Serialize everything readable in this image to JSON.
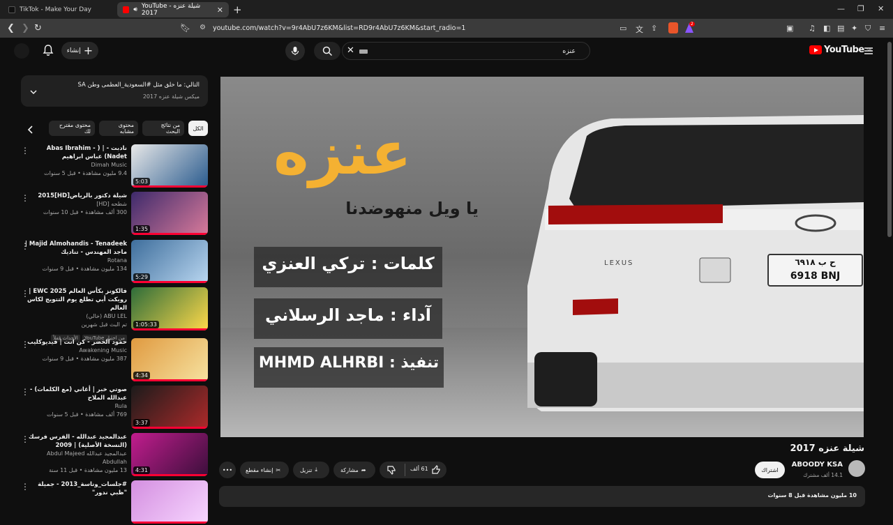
{
  "browser": {
    "tabs": [
      {
        "title": "TikTok - Make Your Day"
      },
      {
        "title": "YouTube - شيلة عنزه 2017"
      }
    ],
    "url": "youtube.com/watch?v=9r4AbU7z6KM&list=RD9r4AbU7z6KM&start_radio=1",
    "badge_count": "2"
  },
  "header": {
    "search_value": "عنزه",
    "create_label": "إنشاء",
    "logo_text": "YouTube",
    "logo_region": "SA"
  },
  "mix": {
    "now_playing": "التالي: ما خلق مثل #السعودية_العظمى وطن SA",
    "subtitle": "ميكس شيلة عنزه 2017"
  },
  "chips": [
    "الكل",
    "من نتائج البحث",
    "محتوى مشابه",
    "محتوى مقترح لك"
  ],
  "sidebar_items": [
    {
      "title": "نادبت - | ( Abas Ibrahim - Nadet) عباس ابراهيم",
      "channel": "Dimah Music",
      "views": "9.4 مليون مشاهدة • قبل 5 سنوات",
      "duration": "5:03",
      "badge": ""
    },
    {
      "title": "شيلة دكتور بالرياض[HD]2015",
      "channel": "شطحه [HD]",
      "views": "300 ألف مشاهدة • قبل 10 سنوات",
      "duration": "1:35",
      "badge": ""
    },
    {
      "title": "Majid Almohandis - Tenadeek | ماجد المهندس - تناديك",
      "channel": "Rotana",
      "views": "134 مليون مشاهدة • قبل 9 سنوات",
      "duration": "5:29",
      "badge": ""
    },
    {
      "title": "فالكونز بكأس العالم EWC 2025 | رويكت أبي تطلع يوم التتويج لكاس العالم",
      "channel": "ABU LEL (خالي)",
      "views": "تم البث قبل شهرين",
      "duration": "1:05:33",
      "badge": "من اختيار YouTube",
      "badge2": "الأحداث قفلاً"
    },
    {
      "title": "حمود الخضر - كن انت | فيديوكليب",
      "channel": "Awakening Music",
      "views": "387 مليون مشاهدة • قبل 9 سنوات",
      "duration": "4:34",
      "badge": ""
    },
    {
      "title": "صوتي خبر | أغاني (مع الكلمات) - عبدالله الملاح",
      "channel": "Rula",
      "views": "769 ألف مشاهدة • قبل 5 سنوات",
      "duration": "3:37",
      "badge": ""
    },
    {
      "title": "عبدالمجيد عبدالله - الفرس فرسك (النسخة الأصلية) | 2009",
      "channel": "عبدالمجيد عبدالله Abdul Majeed Abdullah",
      "views": "13 مليون مشاهدة • قبل 11 سنة",
      "duration": "4:31",
      "badge": ""
    },
    {
      "title": "#جلسات_وناسة_2013 - جميلة \"ظبي ندور\"",
      "channel": "",
      "views": "",
      "duration": "",
      "badge": ""
    }
  ],
  "video": {
    "overlay_title": "عنزه",
    "overlay_subtitle": "يا ويل منهوضدنا",
    "lyrics_line": "كلمات : تركي العنزي",
    "performer_line": "آداء : ماجد الرسلاني",
    "editor_line": "تنفيذ : MHMD ALHRBI",
    "plate_text_ar": "ح ب ٦٩١٨",
    "plate_text": "6918 BNJ",
    "car_badge": "LEXUS"
  },
  "watch": {
    "title": "شيلة عنزه 2017",
    "channel": "ABOODY KSA",
    "subscribers": "14.1 ألف مشترك",
    "subscribe_label": "اشتراك",
    "likes": "61 ألف",
    "share_label": "مشاركة",
    "download_label": "تنزيل",
    "clip_label": "إنشاء مقطع",
    "description": "10 مليون مشاهدة  قبل 8 سنوات"
  },
  "colors": {
    "accent": "#ff0000",
    "bg": "#0f0f0f",
    "surface": "#272727"
  }
}
